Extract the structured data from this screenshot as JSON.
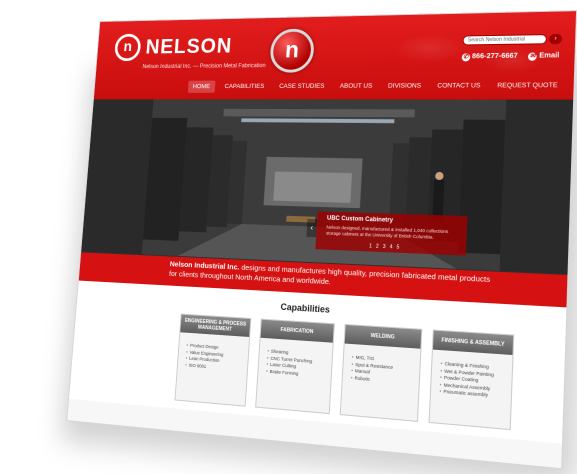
{
  "brand": {
    "logo_letter": "n",
    "name": "NELSON",
    "tagline": "Nelson Industrial Inc. — Precision Metal Fabrication",
    "emblem_letter": "n"
  },
  "header": {
    "search_placeholder": "Search Nelson Industrial",
    "search_button": "›",
    "phone": "866-277-6667",
    "phone_icon": "phone-icon",
    "email_label": "Email",
    "email_icon": "mail-icon"
  },
  "nav": {
    "items": [
      {
        "label": "HOME",
        "active": true
      },
      {
        "label": "CAPABILITIES",
        "active": false
      },
      {
        "label": "CASE STUDIES",
        "active": false
      },
      {
        "label": "ABOUT US",
        "active": false
      },
      {
        "label": "DIVISIONS",
        "active": false
      },
      {
        "label": "CONTACT US",
        "active": false
      },
      {
        "label": "REQUEST QUOTE",
        "active": false
      }
    ]
  },
  "hero": {
    "caption_title": "UBC Custom Cabinetry",
    "caption_text": "Nelson designed, manufactured & installed 1,040 collections storage cabinets at the University of British Columbia.",
    "prev_arrow": "‹",
    "next_arrow": "›",
    "slides": [
      "1",
      "2",
      "3",
      "4",
      "5"
    ]
  },
  "intro": {
    "company": "Nelson Industrial Inc.",
    "text": " designs and manufactures high quality, precision fabricated metal products for clients throughout North America and worldwide."
  },
  "capabilities": {
    "title": "Capabilities",
    "boxes": [
      {
        "title": "ENGINEERING & PROCESS MANAGEMENT",
        "items": [
          "Product Design",
          "Value Engineering",
          "Lean Production",
          "ISO 9001"
        ]
      },
      {
        "title": "FABRICATION",
        "items": [
          "Shearing",
          "CNC Turret Punching",
          "Laser Cutting",
          "Brake Forming"
        ]
      },
      {
        "title": "WELDING",
        "items": [
          "MIG, TIG",
          "Spot & Resistance",
          "Manual",
          "Robotic"
        ]
      },
      {
        "title": "FINISHING & ASSEMBLY",
        "items": [
          "Cleaning & Finishing",
          "Wet & Powder Painting",
          "Powder Coating",
          "Mechanical Assembly",
          "Pneumatic assembly"
        ]
      }
    ]
  },
  "colors": {
    "brand_red": "#d51111",
    "dark_red": "#a00000",
    "hero_gray": "#3a3a3a"
  }
}
